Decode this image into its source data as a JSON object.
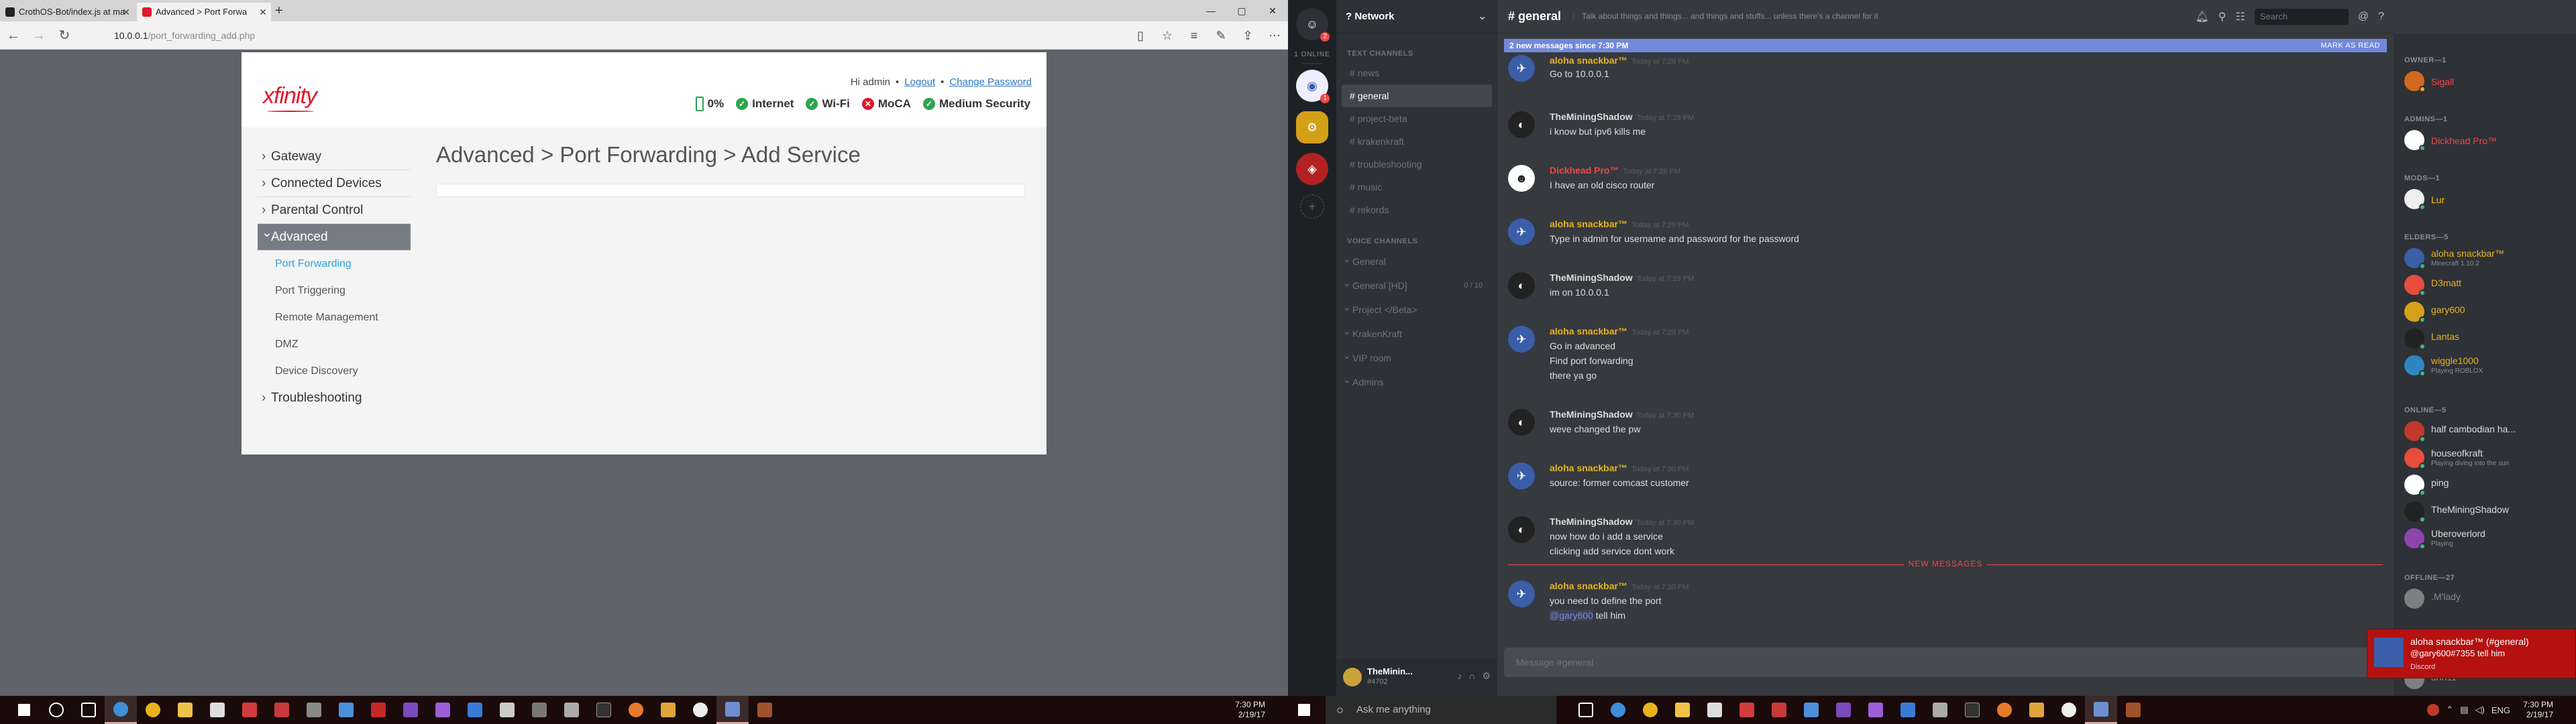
{
  "browser": {
    "tabs": [
      {
        "label": "CrothOS-Bot/index.js at ma",
        "favicon_color": "#222222"
      },
      {
        "label": "Advanced > Port Forwa",
        "favicon_color": "#e1182c"
      }
    ],
    "url_host": "10.0.0.1",
    "url_path": "/port_forwarding_add.php"
  },
  "xfinity": {
    "logo": "xfinity",
    "greeting": "Hi admin",
    "bullet": "•",
    "logout": "Logout",
    "change_password": "Change Password",
    "status": {
      "battery": "0%",
      "internet": "Internet",
      "wifi": "Wi-Fi",
      "moca": "MoCA",
      "security": "Medium Security"
    },
    "nav": {
      "gateway": "Gateway",
      "connected_devices": "Connected Devices",
      "parental_control": "Parental Control",
      "advanced": "Advanced",
      "sub": [
        "Port Forwarding",
        "Port Triggering",
        "Remote Management",
        "DMZ",
        "Device Discovery"
      ],
      "troubleshooting": "Troubleshooting"
    },
    "page_title": "Advanced > Port Forwarding > Add Service"
  },
  "taskbar_left": {
    "time": "7:30 PM",
    "date": "2/19/17"
  },
  "taskbar_right": {
    "search": "Ask me anything",
    "lang": "ENG",
    "time": "7:30 PM",
    "date": "2/19/17"
  },
  "discord": {
    "online_label": "1 ONLINE",
    "server_name": "? Network",
    "text_channels_label": "TEXT CHANNELS",
    "text_channels": [
      "news",
      "general",
      "project-beta",
      "krakenkraft",
      "troubleshooting",
      "music",
      "rekords"
    ],
    "voice_channels_label": "VOICE CHANNELS",
    "voice_channels": [
      {
        "name": "General",
        "count": ""
      },
      {
        "name": "General [HD]",
        "count": "0 / 10"
      },
      {
        "name": "Project </Beta>",
        "count": ""
      },
      {
        "name": "KrakenKraft",
        "count": ""
      },
      {
        "name": "VIP room",
        "count": ""
      },
      {
        "name": "Admins",
        "count": ""
      }
    ],
    "user": {
      "name": "TheMinin...",
      "tag": "#4702"
    },
    "channel_title": "general",
    "topic": "Talk about things and things... and things and stuffs... unless there's a channel for it",
    "header_search": "Search",
    "new_messages_bar": "2 new messages since 7:30 PM",
    "mark_as_read": "MARK AS READ",
    "new_messages_divider": "NEW MESSAGES",
    "messages": [
      {
        "author": "aloha snackbar™",
        "time": "Today at 7:29 PM",
        "lines": [
          "Go to 10.0.0.1"
        ]
      },
      {
        "author": "TheMiningShadow",
        "time": "Today at 7:28 PM",
        "lines": [
          "i know but ipv6 kills me"
        ]
      },
      {
        "author": "Dickhead Pro™",
        "time": "Today at 7:28 PM",
        "lines": [
          "I have an old cisco router"
        ]
      },
      {
        "author": "aloha snackbar™",
        "time": "Today at 7:29 PM",
        "lines": [
          "Type in admin for username and password for the password"
        ]
      },
      {
        "author": "TheMiningShadow",
        "time": "Today at 7:29 PM",
        "lines": [
          "im on 10.0.0.1"
        ]
      },
      {
        "author": "aloha snackbar™",
        "time": "Today at 7:29 PM",
        "lines": [
          "Go in advanced",
          "Find port forwarding",
          "there ya go"
        ]
      },
      {
        "author": "TheMiningShadow",
        "time": "Today at 7:30 PM",
        "lines": [
          "weve changed the pw"
        ]
      },
      {
        "author": "aloha snackbar™",
        "time": "Today at 7:30 PM",
        "lines": [
          "source: former comcast customer"
        ]
      },
      {
        "author": "TheMiningShadow",
        "time": "Today at 7:30 PM",
        "lines": [
          "now how do i add a service",
          "clicking add service dont work"
        ]
      },
      {
        "author": "aloha snackbar™",
        "time": "Today at 7:30 PM",
        "lines": [
          "you need to define the port",
          "tell him"
        ],
        "mention": "@gary600"
      }
    ],
    "composer_placeholder": "Message #general",
    "members": {
      "owner_label": "OWNER—1",
      "admins_label": "ADMINS—1",
      "mods_label": "MODS—1",
      "elders_label": "ELDERS—5",
      "online_label": "ONLINE—5",
      "offline_label": "OFFLINE—27",
      "owner": {
        "name": "Sigall"
      },
      "admin": {
        "name": "Dickhead Pro™"
      },
      "mod": {
        "name": "Lur"
      },
      "elders": [
        {
          "name": "aloha snackbar™",
          "status": "Minecraft 1.10.2"
        },
        {
          "name": "D3matt",
          "status": ""
        },
        {
          "name": "gary600",
          "status": ""
        },
        {
          "name": "Lantas",
          "status": ""
        },
        {
          "name": "wiggle1000",
          "status": "Playing ROBLOX"
        }
      ],
      "online": [
        {
          "name": "half cambodian ha...",
          "status": ""
        },
        {
          "name": "houseofkraft",
          "status": "Playing diving into the sun"
        },
        {
          "name": "ping",
          "status": ""
        },
        {
          "name": "TheMiningShadow",
          "status": ""
        },
        {
          "name": "Uberoverlord",
          "status": "Playing"
        }
      ],
      "offline": [
        {
          "name": ".M'lady",
          "status": ""
        },
        {
          "name": "ahh11",
          "status": ""
        }
      ]
    },
    "toast": {
      "title": "aloha snackbar™ (#general)",
      "body": "@gary600#7355 tell him",
      "app": "Discord"
    }
  },
  "colors": {
    "owner": "#f04747",
    "admin": "#f04747",
    "mod": "#f1c40f",
    "elder": "#e6b31e",
    "member": "#dcddde",
    "accent": "#7289da"
  }
}
